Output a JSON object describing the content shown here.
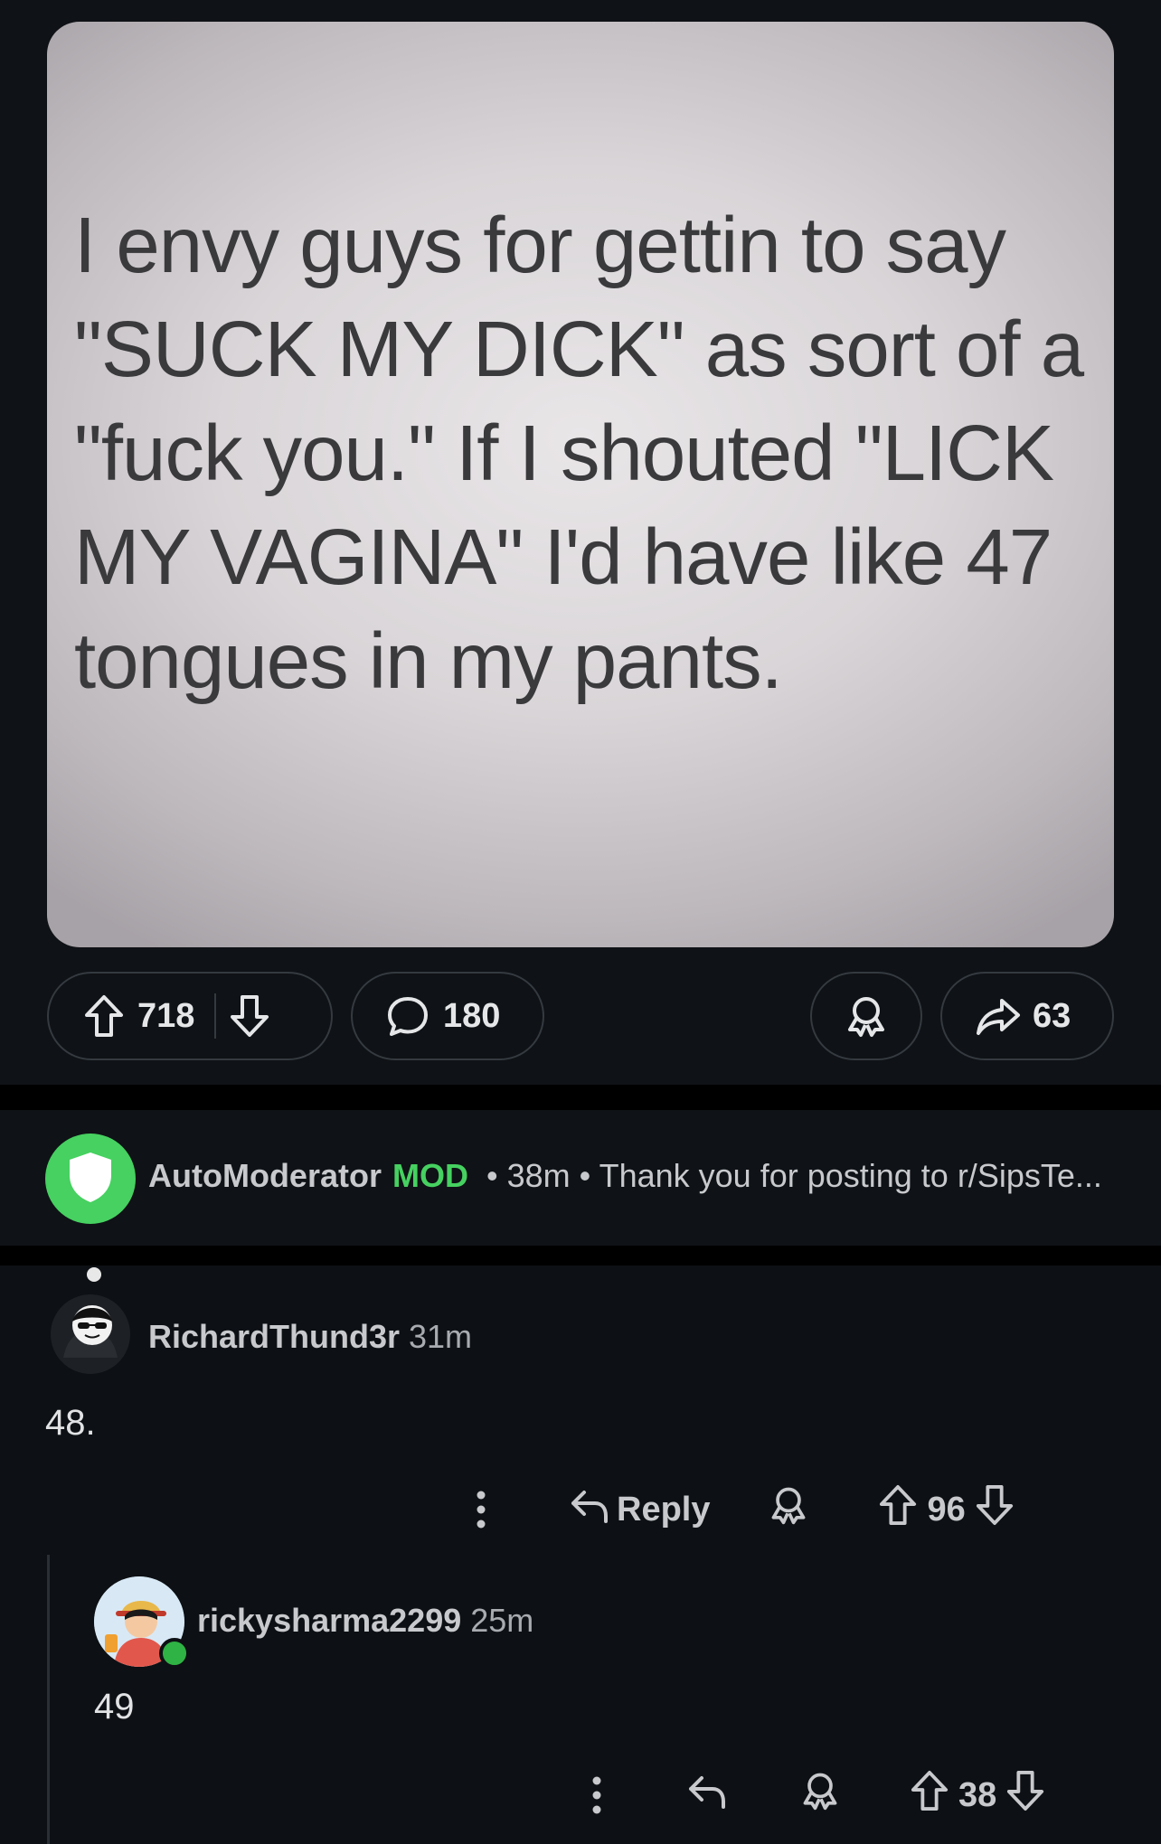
{
  "post": {
    "image_text": "I envy guys for gettin to say \"SUCK MY DICK\" as sort of a \"fuck you.\" If I shouted \"LICK MY VAGINA\" I'd have like 47 tongues in my pants.",
    "upvotes": "718",
    "comments": "180",
    "shares": "63"
  },
  "automod": {
    "name": "AutoModerator",
    "badge": "MOD",
    "meta": "• 38m • Thank you for posting to r/SipsTe..."
  },
  "comments": [
    {
      "username": "RichardThund3r",
      "time": "31m",
      "body": "48.",
      "reply_label": "Reply",
      "votes": "96"
    },
    {
      "username": "rickysharma2299",
      "time": "25m",
      "body": "49",
      "votes": "38"
    }
  ],
  "colors": {
    "background": "#0d1014",
    "mod_green": "#46d160",
    "online_green": "#2fb344",
    "text": "#d7dadc"
  },
  "icons": [
    "upvote-icon",
    "downvote-icon",
    "comment-icon",
    "award-icon",
    "share-icon",
    "shield-icon",
    "more-icon",
    "reply-icon"
  ]
}
